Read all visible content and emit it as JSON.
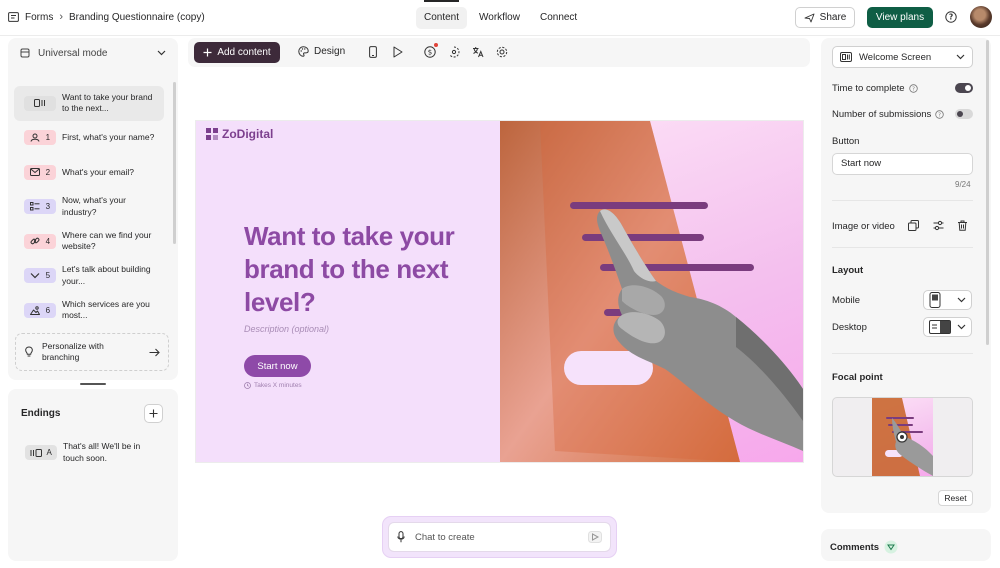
{
  "breadcrumb": {
    "root": "Forms",
    "current": "Branding Questionnaire (copy)"
  },
  "tabs": [
    "Content",
    "Workflow",
    "Connect"
  ],
  "header": {
    "share_label": "Share",
    "plans_label": "View plans"
  },
  "left_panel": {
    "mode_label": "Universal mode",
    "questions": [
      {
        "number": "",
        "label": "Want to take your brand to the next...",
        "icon": "welcome-screen-icon",
        "color": "#e2e2e2"
      },
      {
        "number": "1",
        "label": "First, what's your name?",
        "icon": "contact-icon",
        "color": "#fbd3d8"
      },
      {
        "number": "2",
        "label": "What's your email?",
        "icon": "envelope-icon",
        "color": "#fbd3d8"
      },
      {
        "number": "3",
        "label": "Now, what's your industry?",
        "icon": "list-icon",
        "color": "#dcd6f7"
      },
      {
        "number": "4",
        "label": "Where can we find your website?",
        "icon": "link-icon",
        "color": "#fbd3d8"
      },
      {
        "number": "5",
        "label": "Let's talk about building your...",
        "icon": "chevron-down-icon",
        "color": "#dcd6f7"
      },
      {
        "number": "6",
        "label": "Which services are you most...",
        "icon": "image-choice-icon",
        "color": "#dcd6f7"
      }
    ],
    "personalize_label": "Personalize with branching",
    "endings_title": "Endings",
    "ending_item": {
      "letter": "A",
      "label": "That's all! We'll be in touch soon."
    }
  },
  "toolbar": {
    "add_label": "Add content",
    "design_label": "Design"
  },
  "canvas": {
    "logo": "ZoDigital",
    "headline": "Want to take your brand to the next level?",
    "description": "Description (optional)",
    "button": "Start now",
    "time_note": "Takes X minutes"
  },
  "chat": {
    "placeholder": "Chat to create"
  },
  "right_panel": {
    "screen_select": "Welcome Screen",
    "time_to_complete": {
      "label": "Time to complete",
      "on": true
    },
    "submissions": {
      "label": "Number of submissions",
      "on": false
    },
    "button_label": "Button",
    "button_value": "Start now",
    "counter": "9/24",
    "image_label": "Image or video",
    "layout_title": "Layout",
    "mobile_label": "Mobile",
    "desktop_label": "Desktop",
    "focal_title": "Focal point",
    "reset_label": "Reset",
    "comments_label": "Comments"
  },
  "colors": {
    "accent": "#8e4aa8",
    "plans": "#0f5e45",
    "add_button": "#3d2a3a",
    "canvas_bg": "#f4dffb"
  }
}
